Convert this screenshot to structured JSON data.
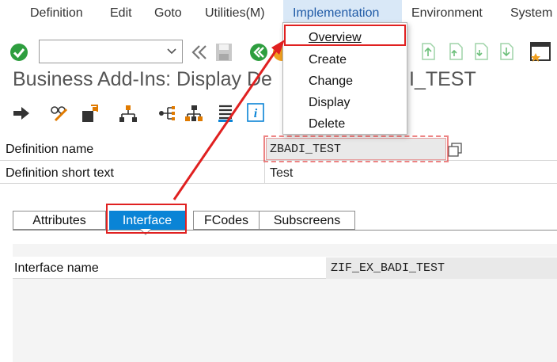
{
  "menubar": {
    "items": [
      "Definition",
      "Edit",
      "Goto",
      "Utilities(M)",
      "Implementation",
      "Environment",
      "System"
    ]
  },
  "toolbar": {
    "command_value": ""
  },
  "page": {
    "title": "Business Add-Ins: Display Definition ZBADI_TEST",
    "title_visible_left": "Business Add-Ins: Display De",
    "title_visible_right": "I_TEST"
  },
  "implementation_menu": {
    "items": [
      "Overview",
      "Create",
      "Change",
      "Display",
      "Delete"
    ]
  },
  "fields": {
    "definition_name_label": "Definition name",
    "definition_name_value": "ZBADI_TEST",
    "short_text_label": "Definition short text",
    "short_text_value": "Test"
  },
  "tabs": [
    "Attributes",
    "Interface",
    "FCodes",
    "Subscreens"
  ],
  "interface": {
    "name_label": "Interface name",
    "name_value": "ZIF_EX_BADI_TEST"
  },
  "colors": {
    "accent": "#0a84d6",
    "menu_active_bg": "#d9e8f7",
    "highlight": "#e02020",
    "ok_green": "#2e9e3f"
  }
}
